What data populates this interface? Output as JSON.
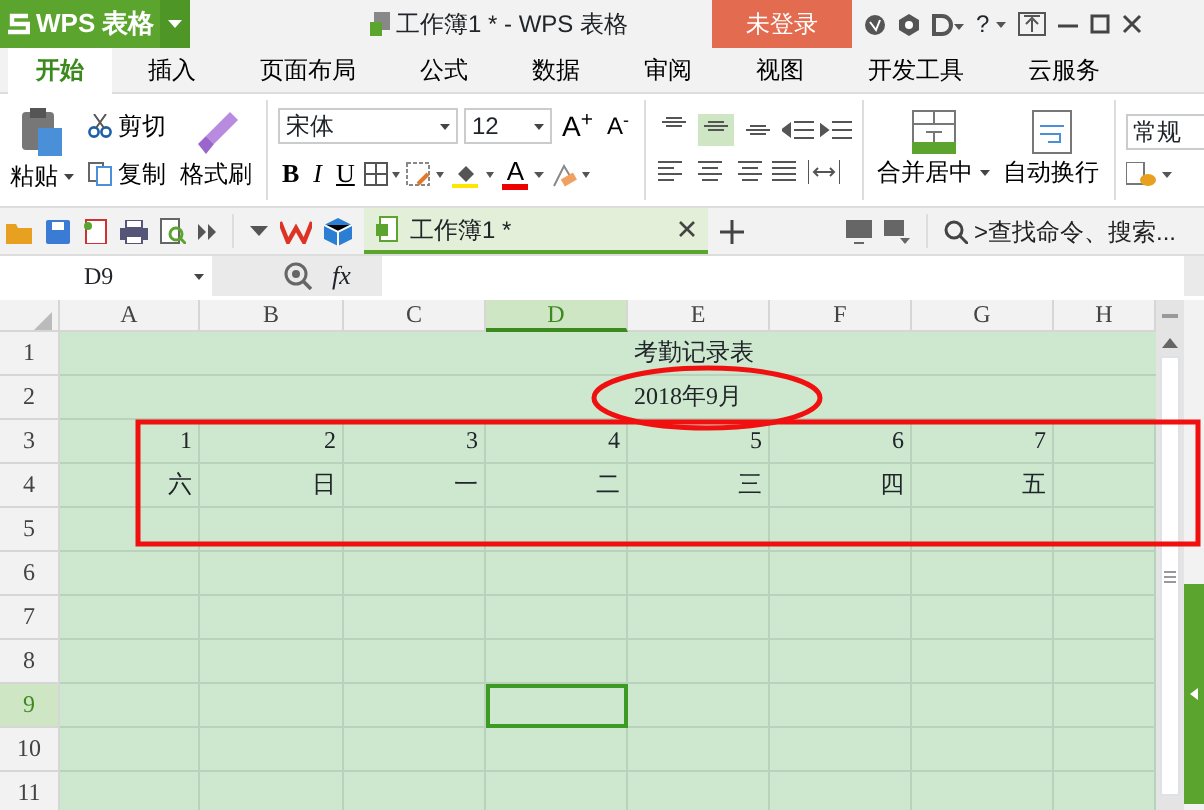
{
  "title_bar": {
    "app_button": "WPS 表格",
    "document_title": "工作簿1 * - WPS 表格",
    "login_button": "未登录",
    "help": "?"
  },
  "tabs": [
    {
      "label": "开始",
      "selected": true
    },
    {
      "label": "插入",
      "selected": false
    },
    {
      "label": "页面布局",
      "selected": false
    },
    {
      "label": "公式",
      "selected": false
    },
    {
      "label": "数据",
      "selected": false
    },
    {
      "label": "审阅",
      "selected": false
    },
    {
      "label": "视图",
      "selected": false
    },
    {
      "label": "开发工具",
      "selected": false
    },
    {
      "label": "云服务",
      "selected": false
    }
  ],
  "ribbon": {
    "paste": "粘贴",
    "cut": "剪切",
    "copy": "复制",
    "format_painter": "格式刷",
    "font_name": "宋体",
    "font_size": "12",
    "grow_font": "A$^{+}$",
    "shrink_font": "A$^{-}$",
    "bold": "B",
    "italic": "I",
    "underline": "U",
    "font_color": "A",
    "vertical_align": [
      {
        "selected": false
      },
      {
        "selected": true
      },
      {
        "selected": false
      }
    ],
    "merge_center": "合并居中",
    "wrap_text": "自动换行",
    "number_format": "常规"
  },
  "doc_tabs": [
    {
      "label": "工作簿1 *",
      "selected": true
    }
  ],
  "search": {
    "placeholder": ">查找命令、搜索..."
  },
  "formula_bar": {
    "name_box": "D9",
    "function_label": "fx"
  },
  "sheet": {
    "columns": [
      {
        "label": "A",
        "selected": false
      },
      {
        "label": "B",
        "selected": false
      },
      {
        "label": "C",
        "selected": false
      },
      {
        "label": "D",
        "selected": true
      },
      {
        "label": "E",
        "selected": false
      },
      {
        "label": "F",
        "selected": false
      },
      {
        "label": "G",
        "selected": false
      },
      {
        "label": "H",
        "selected": false
      }
    ],
    "rows": [
      {
        "number": "1",
        "selected": false,
        "merged_text": "考勤记录表"
      },
      {
        "number": "2",
        "selected": false,
        "merged_text": "2018年9月"
      },
      {
        "number": "3",
        "selected": false,
        "cells": [
          "1",
          "2",
          "3",
          "4",
          "5",
          "6",
          "7"
        ]
      },
      {
        "number": "4",
        "selected": false,
        "cells": [
          "六",
          "日",
          "一",
          "二",
          "三",
          "四",
          "五"
        ]
      },
      {
        "number": "5",
        "selected": false
      },
      {
        "number": "6",
        "selected": false
      },
      {
        "number": "7",
        "selected": false
      },
      {
        "number": "8",
        "selected": false
      },
      {
        "number": "9",
        "selected": true
      },
      {
        "number": "10",
        "selected": false
      },
      {
        "number": "11",
        "selected": false
      }
    ],
    "annotations": [
      {
        "kind": "ellipse"
      },
      {
        "kind": "rectangle"
      }
    ]
  }
}
